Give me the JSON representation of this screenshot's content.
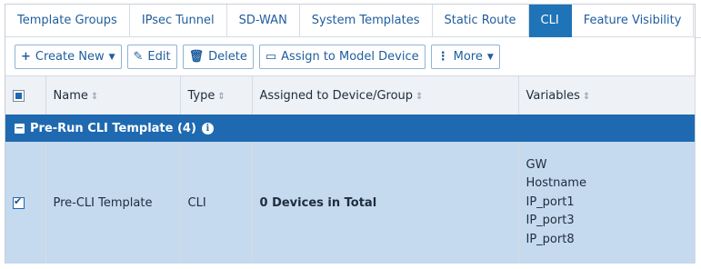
{
  "tabs": [
    {
      "label": "Template Groups",
      "active": false
    },
    {
      "label": "IPsec Tunnel",
      "active": false
    },
    {
      "label": "SD-WAN",
      "active": false
    },
    {
      "label": "System Templates",
      "active": false
    },
    {
      "label": "Static Route",
      "active": false
    },
    {
      "label": "CLI",
      "active": true
    },
    {
      "label": "Feature Visibility",
      "active": false
    }
  ],
  "toolbar": {
    "create_new": "Create New",
    "edit": "Edit",
    "delete": "Delete",
    "assign": "Assign to Model Device",
    "more": "More"
  },
  "table": {
    "columns": [
      "Name",
      "Type",
      "Assigned to Device/Group",
      "Variables"
    ],
    "group": {
      "label": "Pre-Run CLI Template (4)"
    },
    "rows": [
      {
        "checked": true,
        "name": "Pre-CLI Template",
        "type": "CLI",
        "assigned": "0 Devices in Total",
        "variables": [
          "GW",
          "Hostname",
          "IP_port1",
          "IP_port3",
          "IP_port8"
        ]
      }
    ]
  },
  "colors": {
    "accent": "#1f73b7",
    "group_header": "#1f69b0",
    "selected_row": "#c5d9ef",
    "header_bg": "#eef1f5"
  }
}
